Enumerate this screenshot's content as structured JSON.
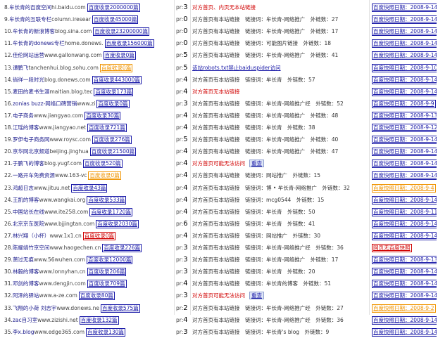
{
  "rows": [
    {
      "num": "8.",
      "name": "牟长青的百度空间",
      "domain": "hi.baidu.com",
      "badge": "百度收录2000000篇",
      "badge_color": "blue",
      "pr_label": "pr:",
      "pr": "3",
      "info": "对方首页、内页无本站链接",
      "info_style": "red",
      "check": "",
      "date": "百度快照日期：2008-9-14",
      "date_color": "blue"
    },
    {
      "num": "9.",
      "name": "牟长青的互联专栏",
      "domain": "column.iresear",
      "badge": "百度收录45000篇",
      "badge_color": "blue",
      "pr_label": "pr:",
      "pr": "0",
      "info": "对方首页有本站链接　链接词：牟长青-网络推广　外链数：27",
      "info_style": "dark",
      "check": "",
      "date": "百度快照日期：2008-9-14",
      "date_color": "blue"
    },
    {
      "num": "10.",
      "name": "牟长青的新浪博客",
      "domain": "blog.sina.com",
      "badge": "百度收录23200000篇",
      "badge_color": "blue",
      "pr_label": "pr:",
      "pr": "0",
      "info": "对方首页有本站链接　链接词：牟长青-网络推广　外链数：17",
      "info_style": "dark",
      "check": "",
      "date": "百度快照日期：2008-9-14",
      "date_color": "blue"
    },
    {
      "num": "11.",
      "name": "牟长青的donews专栏",
      "domain": "home.donews.",
      "badge": "百度收录156000篇",
      "badge_color": "blue",
      "pr_label": "pr:",
      "pr": "0",
      "info": "对方首页有本站链接　链接词：可能图片链接　外链数：18",
      "info_style": "dark",
      "check": "",
      "date": "百度快照日期：2008-9-14",
      "date_color": "blue"
    },
    {
      "num": "12.",
      "name": "佳伦网站运营",
      "domain": "www.gallonwang.com",
      "badge": "百度收录0篇",
      "badge_color": "blue",
      "pr_label": "pr:",
      "pr": "5",
      "info": "对方首页有本站链接　链接词：牟长青-网络推广　外链数：41",
      "info_style": "dark",
      "check": "",
      "date": "百度快照日期：2008-9-14",
      "date_color": "blue"
    },
    {
      "num": "13.",
      "name": "谭鹏飞",
      "domain": "tanchenhui.blog.sohu.com",
      "badge": "百度收录0篇",
      "badge_color": "orange",
      "pr_label": "pr:",
      "pr": "5",
      "info": "该站robots.txt禁止baiduspider访问",
      "info_style": "blue",
      "check": "",
      "date": "百度快照日期：2008-9-10",
      "date_color": "blue"
    },
    {
      "num": "14.",
      "name": "徜徉一段时光",
      "domain": "blog.donews.com",
      "badge": "百度收录443000篇",
      "badge_color": "blue",
      "pr_label": "pr:",
      "pr": "4",
      "info": "对方首页有本站链接　链接词：牟长青　外链数：57",
      "info_style": "dark",
      "check": "",
      "date": "百度快照日期：2008-9-14",
      "date_color": "blue"
    },
    {
      "num": "15.",
      "name": "麦田的麦书生涯",
      "domain": "maitian.blog.tec",
      "badge": "百度收录173篇",
      "badge_color": "blue",
      "pr_label": "pr:",
      "pr": "4",
      "info": "对方首页无本站链接",
      "info_style": "red",
      "check": "",
      "date": "百度快照日期：2008-9-14",
      "date_color": "blue"
    },
    {
      "num": "16.",
      "name": "zonias buzz-网络口碑营销",
      "domain": "www.zi",
      "badge": "百度收录0篇",
      "badge_color": "blue",
      "pr_label": "pr:",
      "pr": "3",
      "info": "对方首页有本站链接　链接词：牟长青-网络推广经　外链数：52",
      "info_style": "dark",
      "check": "",
      "date": "百度快照日期：2008-9-9",
      "date_color": "blue"
    },
    {
      "num": "17.",
      "name": "电子商务",
      "domain": "www.jiangyao.com",
      "badge": "百度收录30篇",
      "badge_color": "blue",
      "pr_label": "pr:",
      "pr": "4",
      "info": "对方首页有本站链接　链接词：牟长青-网络推广　外链数：48",
      "info_style": "dark",
      "check": "",
      "date": "百度快照日期：2008-9-13",
      "date_color": "blue"
    },
    {
      "num": "18.",
      "name": "江瑶的博客",
      "domain": "www.jiangyao.net",
      "badge": "百度收录721篇",
      "badge_color": "blue",
      "pr_label": "pr:",
      "pr": "4",
      "info": "对方首页有本站链接　链接词：牟长青　外链数：38",
      "info_style": "dark",
      "check": "",
      "date": "百度快照日期：2008-9-12",
      "date_color": "blue"
    },
    {
      "num": "19.",
      "name": "罗伊电子商务网",
      "domain": "www.roysc.com",
      "badge": "百度收录276篇",
      "badge_color": "blue",
      "pr_label": "pr:",
      "pr": "5",
      "info": "对方首页有本站链接　链接词：牟长青-网络推广　外链数：40",
      "info_style": "dark",
      "check": "",
      "date": "百度快照日期：2008-9-14",
      "date_color": "blue"
    },
    {
      "num": "20.",
      "name": "京华网北京频道",
      "domain": "beijing.jinghua",
      "badge": "百度收录21500篇",
      "badge_color": "blue",
      "pr_label": "pr:",
      "pr": "4",
      "info": "对方首页有本站链接　链接词：牟长青-网络推广　外链数：47",
      "info_style": "dark",
      "check": "",
      "date": "百度快照日期：2008-9-14",
      "date_color": "blue"
    },
    {
      "num": "21.",
      "name": "于鹏飞的博客",
      "domain": "blog.yugf.com",
      "badge": "百度收录520篇",
      "badge_color": "blue",
      "pr_label": "pr:",
      "pr": "4",
      "info": "对方首页可能无法访问",
      "info_style": "red",
      "check": "重查",
      "date": "百度快照日期：2008-9-14",
      "date_color": "blue"
    },
    {
      "num": "22.",
      "name": "一路开车免费资源",
      "domain": "www.163-vc",
      "badge": "百度收录0篇",
      "badge_color": "orange",
      "pr_label": "pr:",
      "pr": "4",
      "info": "对方首页有本站链接　链接词：网站推广　外链数：15",
      "info_style": "dark",
      "check": "",
      "date": "百度快照日期：2008-9-14",
      "date_color": "blue"
    },
    {
      "num": "23.",
      "name": "鸿超日志",
      "domain": "www.jituu.net",
      "badge": "百度收录43篇",
      "badge_color": "blue",
      "pr_label": "pr:",
      "pr": "4",
      "info": "对方首页有本站链接　链接词：博 • 牟长青-网络推广　外链数：32",
      "info_style": "dark",
      "check": "",
      "date": "百度快照日期：2008-9-4",
      "date_color": "orange"
    },
    {
      "num": "24.",
      "name": "王凯的博客",
      "domain": "www.wangkai.org",
      "badge": "百度收录533篇",
      "badge_color": "blue",
      "pr_label": "pr:",
      "pr": "4",
      "info": "对方首页有本站链接　链接词：mcg0544　外链数：15",
      "info_style": "dark",
      "check": "",
      "date": "百度快照日期：2008-9-14",
      "date_color": "blue"
    },
    {
      "num": "25.",
      "name": "中国站长在线",
      "domain": "www.ite258.com",
      "badge": "百度收录1720篇",
      "badge_color": "blue",
      "pr_label": "pr:",
      "pr": "4",
      "info": "对方首页有本站链接　链接词：牟长青　外链数：50",
      "info_style": "dark",
      "check": "",
      "date": "百度快照日期：2008-9-11",
      "date_color": "blue"
    },
    {
      "num": "26.",
      "name": "北京京东医院",
      "domain": "www.bjjingtan.com",
      "badge": "百度收录2030篇",
      "badge_color": "blue",
      "pr_label": "pr:",
      "pr": "6",
      "info": "对方首页有本站链接　链接词：牟长青　外链数：41",
      "info_style": "dark",
      "check": "",
      "date": "百度快照日期：2008-9-14",
      "date_color": "blue"
    },
    {
      "num": "27.",
      "name": "林兴翔（小杯）",
      "domain": "www.1x1.cn",
      "badge": "百度收录0篇",
      "badge_color": "red",
      "pr_label": "pr:",
      "pr": "4",
      "info": "对方首页有本站链接　链接词：网站推广　外链数：30",
      "info_style": "dark",
      "check": "",
      "date": "百度快照日期：2008-9-14",
      "date_color": "blue"
    },
    {
      "num": "28.",
      "name": "陈耀靖竹京空间",
      "domain": "www.haogechen.cn",
      "badge": "百度收录226篇",
      "badge_color": "blue",
      "pr_label": "pr:",
      "pr": "3",
      "info": "对方首页有本站链接　链接词：牟长青-网络推广经　外链数：36",
      "info_style": "dark",
      "check": "",
      "date": "网页无百度快照",
      "date_color": "red"
    },
    {
      "num": "29.",
      "name": "萧过无痕",
      "domain": "www.56wuhen.com",
      "badge": "百度收录12000篇",
      "badge_color": "blue",
      "pr_label": "pr:",
      "pr": "3",
      "info": "对方首页有本站链接　链接词：牟长青-网络推广　外链数：17",
      "info_style": "dark",
      "check": "",
      "date": "百度快照日期：2008-9-13",
      "date_color": "blue"
    },
    {
      "num": "30.",
      "name": "林毅的博客",
      "domain": "www.lonnyhan.cn",
      "badge": "百度收录206篇",
      "badge_color": "blue",
      "pr_label": "pr:",
      "pr": "3",
      "info": "对方首页有本站链接　链接词：牟长青　外链数：20",
      "info_style": "dark",
      "check": "",
      "date": "百度快照日期：2008-9-14",
      "date_color": "blue"
    },
    {
      "num": "31.",
      "name": "邓剑的博客",
      "domain": "www.dengjin.com",
      "badge": "百度收录709篇",
      "badge_color": "blue",
      "pr_label": "pr:",
      "pr": "4",
      "info": "对方首页有本站链接　链接词：牟长青的博客　外链数：51",
      "info_style": "dark",
      "check": "",
      "date": "百度快照日期：2008-9-14",
      "date_color": "blue"
    },
    {
      "num": "32.",
      "name": "阿泽的驿站",
      "domain": "www.a-ze.com",
      "badge": "百度收录80篇",
      "badge_color": "blue",
      "pr_label": "pr:",
      "pr": "3",
      "info": "对方首页可能无法访问",
      "info_style": "red",
      "check": "重查",
      "date": "百度快照日期：2008-9-14",
      "date_color": "blue"
    },
    {
      "num": "33.",
      "name": "飞翔的小荷 刘志宇",
      "domain": "www.donews.ne",
      "badge": "百度收录575篇",
      "badge_color": "blue",
      "pr_label": "pr:",
      "pr": "2",
      "info": "对方首页有本站链接　链接词：牟长青-网络推广经　外链数：27",
      "info_style": "dark",
      "check": "",
      "date": "百度快照日期：2008-9-2",
      "date_color": "orange"
    },
    {
      "num": "34.",
      "name": "zac自习室",
      "domain": "www.zizishi.net",
      "badge": "百度收录132篇",
      "badge_color": "blue",
      "pr_label": "pr:",
      "pr": "4",
      "info": "对方首页有本站链接　链接词：牟长青-网络推广经　外链数：36",
      "info_style": "dark",
      "check": "",
      "date": "百度快照日期：2008-9-14",
      "date_color": "blue"
    },
    {
      "num": "35.",
      "name": "李x.blog",
      "domain": "www.edge365.com",
      "badge": "百度收录130篇",
      "badge_color": "blue",
      "pr_label": "pr:",
      "pr": "3",
      "info": "对方首页有本站链接　链接词：牟长青's blog　外链数：9",
      "info_style": "dark",
      "check": "",
      "date": "百度快照日期：2008-9-14",
      "date_color": "blue"
    }
  ]
}
